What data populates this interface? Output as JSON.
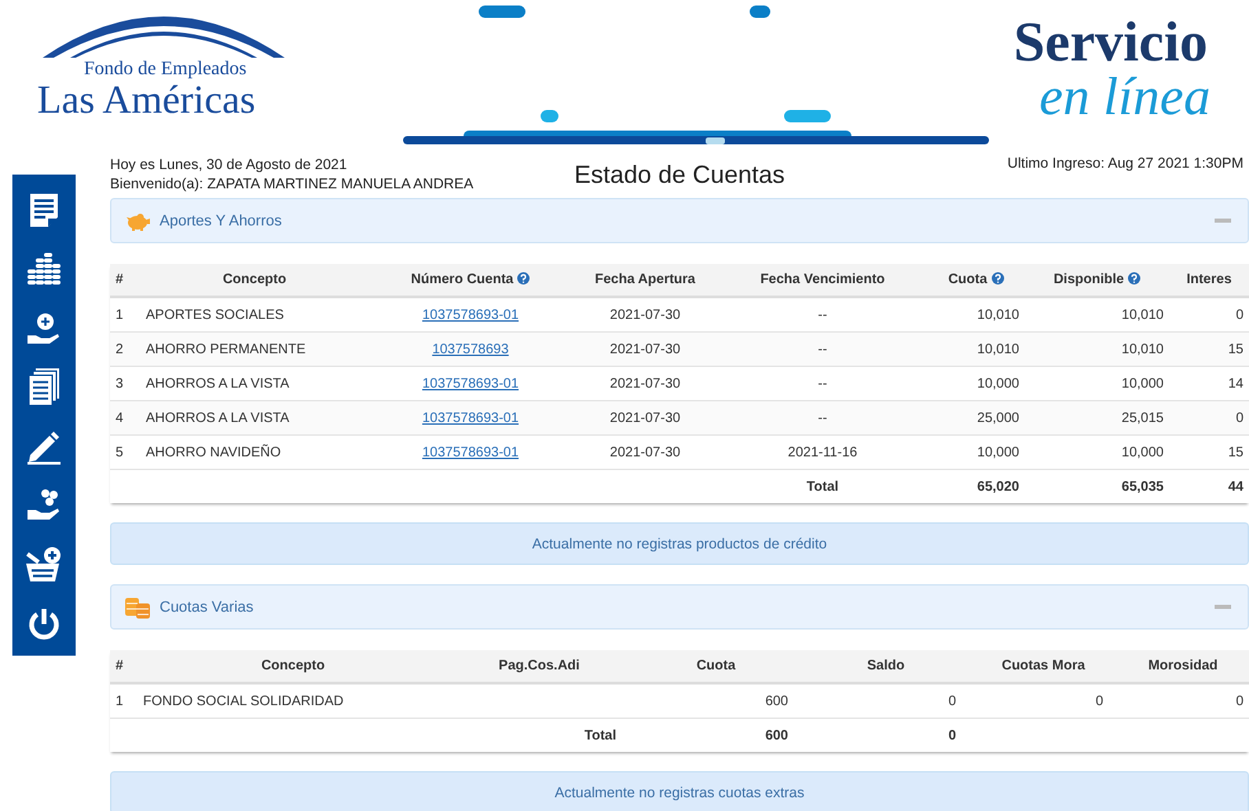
{
  "header": {
    "logo_small": "Fondo de Empleados",
    "logo_large": "Las Américas",
    "service_title": "Servicio",
    "service_subtitle": "en línea"
  },
  "info": {
    "date": "Hoy es Lunes, 30 de Agosto de 2021",
    "welcome": "Bienvenido(a): ZAPATA MARTINEZ MANUELA ANDREA",
    "title": "Estado de Cuentas",
    "last_login": "Ultimo Ingreso: Aug 27 2021 1:30PM"
  },
  "savings": {
    "title": "Aportes Y Ahorros",
    "expanded": true,
    "columns": [
      {
        "label": "#",
        "help": false
      },
      {
        "label": "Concepto",
        "help": false
      },
      {
        "label": "Número Cuenta",
        "help": true
      },
      {
        "label": "Fecha Apertura",
        "help": false
      },
      {
        "label": "Fecha Vencimiento",
        "help": false
      },
      {
        "label": "Cuota",
        "help": true
      },
      {
        "label": "Disponible",
        "help": true
      },
      {
        "label": "Interes",
        "help": false
      }
    ],
    "rows": [
      {
        "num": "1",
        "concepto": "APORTES SOCIALES",
        "cuenta": "1037578693-01",
        "apertura": "2021-07-30",
        "vencimiento": "--",
        "cuota": "10,010",
        "disponible": "10,010",
        "interes": "0"
      },
      {
        "num": "2",
        "concepto": "AHORRO PERMANENTE",
        "cuenta": "1037578693",
        "apertura": "2021-07-30",
        "vencimiento": "--",
        "cuota": "10,010",
        "disponible": "10,010",
        "interes": "15"
      },
      {
        "num": "3",
        "concepto": "AHORROS A LA VISTA",
        "cuenta": "1037578693-01",
        "apertura": "2021-07-30",
        "vencimiento": "--",
        "cuota": "10,000",
        "disponible": "10,000",
        "interes": "14"
      },
      {
        "num": "4",
        "concepto": "AHORROS A LA VISTA",
        "cuenta": "1037578693-01",
        "apertura": "2021-07-30",
        "vencimiento": "--",
        "cuota": "25,000",
        "disponible": "25,015",
        "interes": "0"
      },
      {
        "num": "5",
        "concepto": "AHORRO NAVIDEÑO",
        "cuenta": "1037578693-01",
        "apertura": "2021-07-30",
        "vencimiento": "2021-11-16",
        "cuota": "10,000",
        "disponible": "10,000",
        "interes": "15"
      }
    ],
    "total": {
      "label": "Total",
      "cuota": "65,020",
      "disponible": "65,035",
      "interes": "44"
    }
  },
  "credit_notice": "Actualmente no registras productos de crédito",
  "fees": {
    "title": "Cuotas Varias",
    "expanded": true,
    "columns": [
      {
        "label": "#"
      },
      {
        "label": "Concepto"
      },
      {
        "label": "Pag.Cos.Adi"
      },
      {
        "label": "Cuota"
      },
      {
        "label": "Saldo"
      },
      {
        "label": "Cuotas Mora"
      },
      {
        "label": "Morosidad"
      }
    ],
    "rows": [
      {
        "num": "1",
        "concepto": "FONDO SOCIAL SOLIDARIDAD",
        "cuota": "600",
        "saldo": "0",
        "cuotas_mora": "0",
        "morosidad": "0"
      }
    ],
    "total": {
      "label": "Total",
      "cuota": "600",
      "saldo": "0"
    }
  },
  "extras_notice": "Actualmente no registras cuotas extras"
}
